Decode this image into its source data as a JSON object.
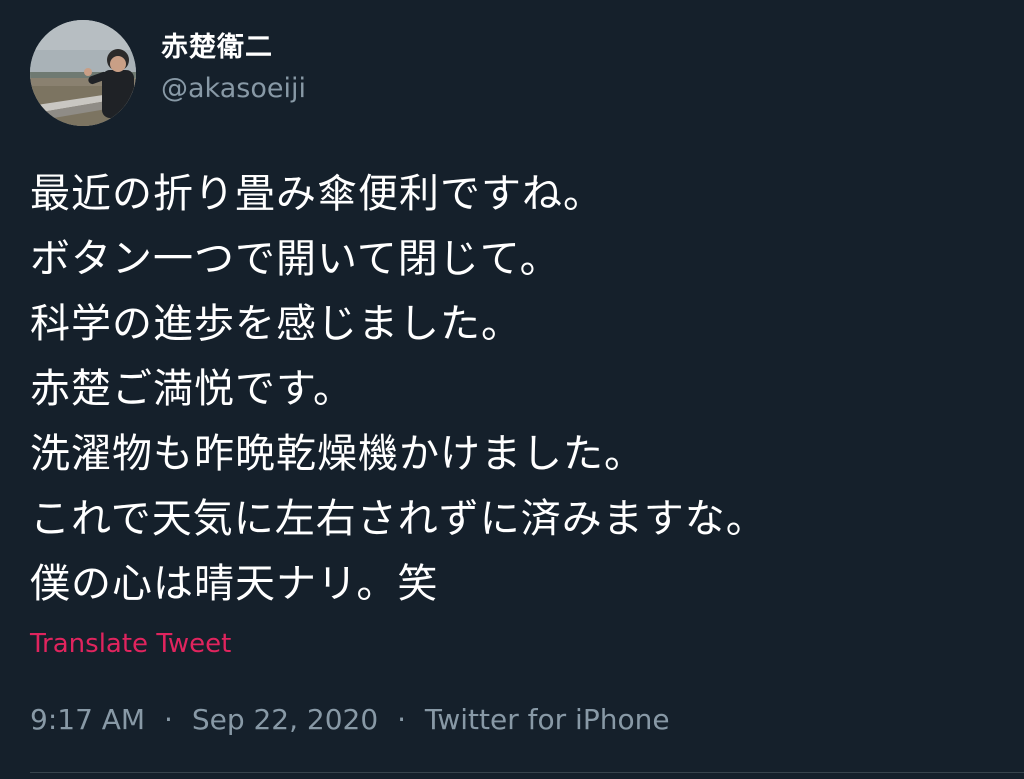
{
  "user": {
    "display_name": "赤楚衛二",
    "handle": "@akasoeiji"
  },
  "tweet": {
    "lines": [
      "最近の折り畳み傘便利ですね。",
      "ボタン一つで開いて閉じて。",
      "科学の進歩を感じました。",
      "赤楚ご満悦です。",
      "洗濯物も昨晩乾燥機かけました。",
      "これで天気に左右されずに済みますな。",
      "僕の心は晴天ナリ。笑"
    ],
    "translate_label": "Translate Tweet",
    "time": "9:17 AM",
    "date": "Sep 22, 2020",
    "separator": "·",
    "source": "Twitter for iPhone"
  },
  "colors": {
    "background": "#15202b",
    "primary_text": "#ffffff",
    "secondary_text": "#8899a6",
    "translate_link": "#e0245e",
    "divider": "#38444d"
  },
  "icons": {
    "avatar": "profile-photo"
  }
}
